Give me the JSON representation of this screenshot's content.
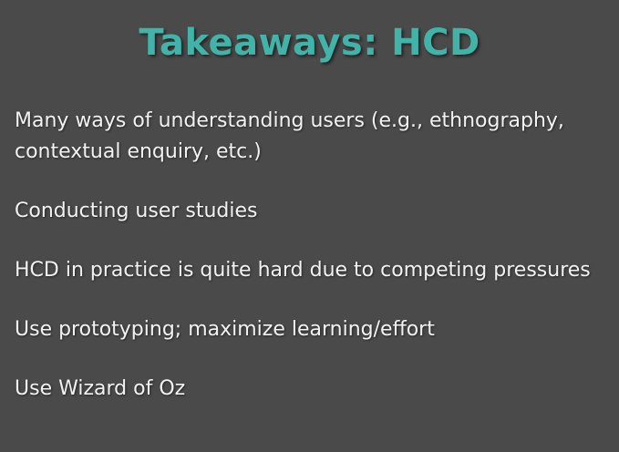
{
  "slide": {
    "title": "Takeaways: HCD",
    "bullets": [
      "Many ways of understanding users (e.g., ethnography, contextual enquiry, etc.)",
      "Conducting user studies",
      "HCD in practice is quite hard due to competing pressures",
      "Use prototyping; maximize learning/effort",
      "Use Wizard of Oz"
    ]
  },
  "colors": {
    "background": "#4a4a4a",
    "title": "#41b3a8",
    "text": "#f2f2f2"
  }
}
